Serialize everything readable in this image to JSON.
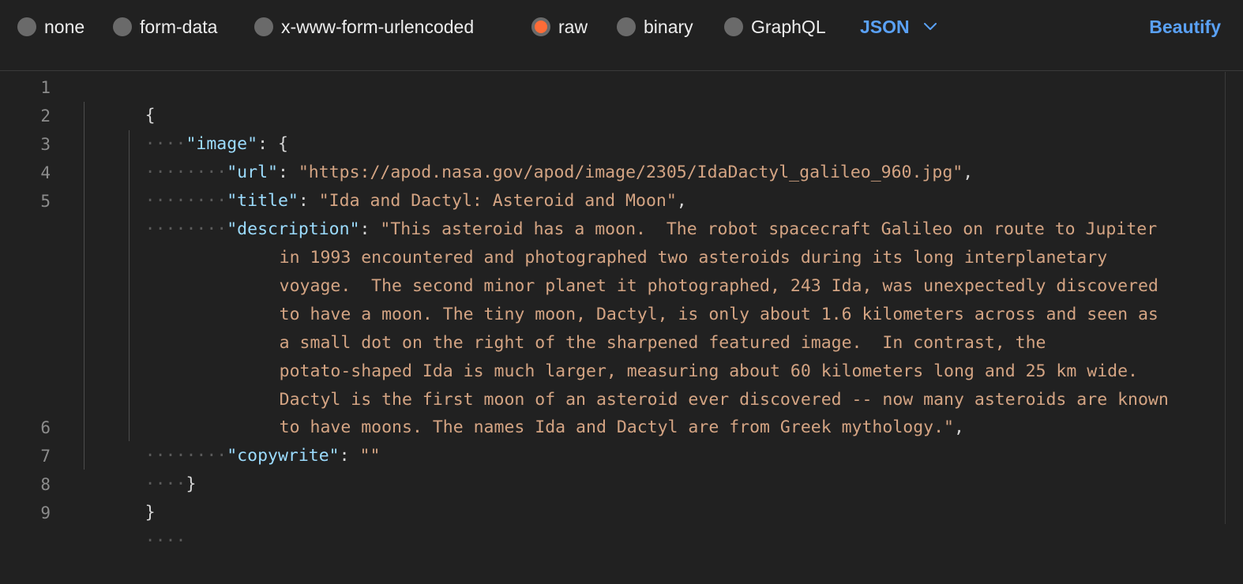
{
  "body_types": [
    {
      "label": "none",
      "selected": false
    },
    {
      "label": "form-data",
      "selected": false
    },
    {
      "label": "x-www-form-urlencoded",
      "selected": false
    },
    {
      "label": "raw",
      "selected": true
    },
    {
      "label": "binary",
      "selected": false
    },
    {
      "label": "GraphQL",
      "selected": false
    }
  ],
  "language_select": {
    "value": "JSON"
  },
  "beautify_label": "Beautify",
  "colors": {
    "accent": "#5aa1f6",
    "radio_selected": "#ff6c37",
    "key": "#9cdcfe",
    "string": "#d4a483",
    "background": "#212121"
  },
  "editor": {
    "line_numbers": [
      "1",
      "2",
      "3",
      "4",
      "5",
      "6",
      "7",
      "8",
      "9"
    ],
    "lines": {
      "l1_brace": "{",
      "l2_key": "\"image\"",
      "l2_rest": ": {",
      "l3_key": "\"url\"",
      "l3_value": "\"https://apod.nasa.gov/apod/image/2305/IdaDactyl_galileo_960.jpg\"",
      "l4_key": "\"title\"",
      "l4_value": "\"Ida and Dactyl: Asteroid and Moon\"",
      "l5_key": "\"description\"",
      "l5_value_wrapped": [
        "\"This asteroid has a moon.  The robot spacecraft Galileo on route to Jupiter",
        "in 1993 encountered and photographed two asteroids during its long interplanetary",
        "voyage.  The second minor planet it photographed, 243 Ida, was unexpectedly discovered",
        "to have a moon. The tiny moon, Dactyl, is only about 1.6 kilometers across and seen as",
        "a small dot on the right of the sharpened featured image.  In contrast, the",
        "potato-shaped Ida is much larger, measuring about 60 kilometers long and 25 km wide.",
        "Dactyl is the first moon of an asteroid ever discovered -- now many asteroids are known",
        "to have moons. The names Ida and Dactyl are from Greek mythology.\""
      ],
      "l6_key": "\"copywrite\"",
      "l6_value": "\"\"",
      "l7_brace": "}",
      "l8_brace": "}"
    }
  }
}
